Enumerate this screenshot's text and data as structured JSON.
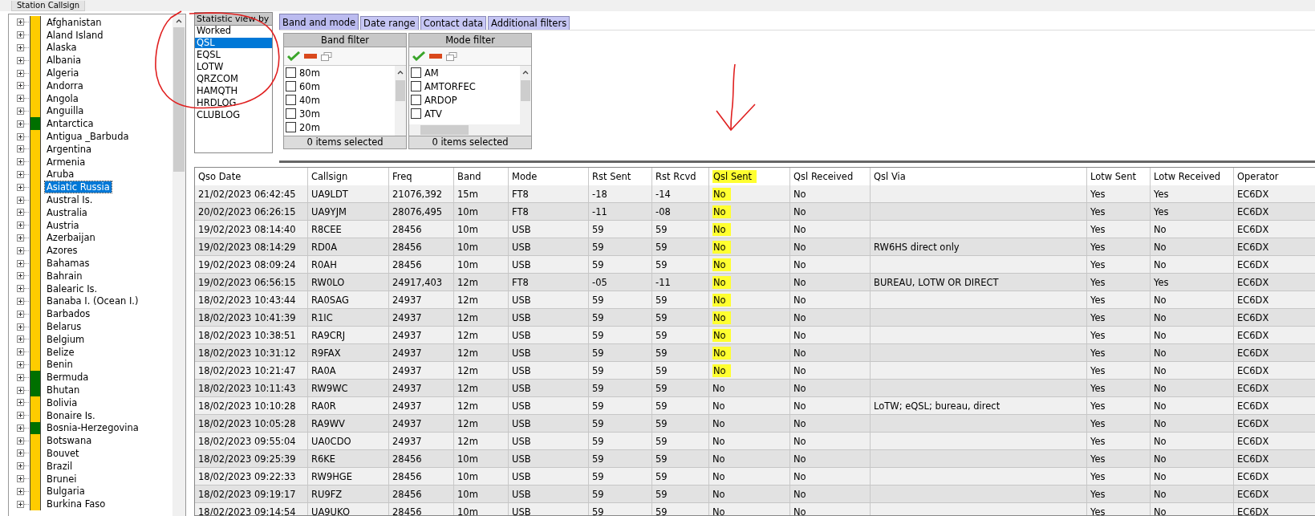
{
  "station_field": {
    "label": "Station Callsign"
  },
  "tree": {
    "items": [
      {
        "label": "Afghanistan",
        "color": "#ffcc00",
        "selected": false
      },
      {
        "label": "Aland Island",
        "color": "#ffcc00",
        "selected": false
      },
      {
        "label": "Alaska",
        "color": "#ffcc00",
        "selected": false
      },
      {
        "label": "Albania",
        "color": "#ffcc00",
        "selected": false
      },
      {
        "label": "Algeria",
        "color": "#ffcc00",
        "selected": false
      },
      {
        "label": "Andorra",
        "color": "#ffcc00",
        "selected": false
      },
      {
        "label": "Angola",
        "color": "#ffcc00",
        "selected": false
      },
      {
        "label": "Anguilla",
        "color": "#ffcc00",
        "selected": false
      },
      {
        "label": "Antarctica",
        "color": "#007000",
        "selected": false
      },
      {
        "label": "Antigua _Barbuda",
        "color": "#ffcc00",
        "selected": false
      },
      {
        "label": "Argentina",
        "color": "#ffcc00",
        "selected": false
      },
      {
        "label": "Armenia",
        "color": "#ffcc00",
        "selected": false
      },
      {
        "label": "Aruba",
        "color": "#ffcc00",
        "selected": false
      },
      {
        "label": "Asiatic Russia",
        "color": "#ffcc00",
        "selected": true
      },
      {
        "label": "Austral Is.",
        "color": "#ffcc00",
        "selected": false
      },
      {
        "label": "Australia",
        "color": "#ffcc00",
        "selected": false
      },
      {
        "label": "Austria",
        "color": "#ffcc00",
        "selected": false
      },
      {
        "label": "Azerbaijan",
        "color": "#ffcc00",
        "selected": false
      },
      {
        "label": "Azores",
        "color": "#ffcc00",
        "selected": false
      },
      {
        "label": "Bahamas",
        "color": "#ffcc00",
        "selected": false
      },
      {
        "label": "Bahrain",
        "color": "#ffcc00",
        "selected": false
      },
      {
        "label": "Balearic Is.",
        "color": "#ffcc00",
        "selected": false
      },
      {
        "label": "Banaba I. (Ocean I.)",
        "color": "#ffcc00",
        "selected": false
      },
      {
        "label": "Barbados",
        "color": "#ffcc00",
        "selected": false
      },
      {
        "label": "Belarus",
        "color": "#ffcc00",
        "selected": false
      },
      {
        "label": "Belgium",
        "color": "#ffcc00",
        "selected": false
      },
      {
        "label": "Belize",
        "color": "#ffcc00",
        "selected": false
      },
      {
        "label": "Benin",
        "color": "#ffcc00",
        "selected": false
      },
      {
        "label": "Bermuda",
        "color": "#007000",
        "selected": false
      },
      {
        "label": "Bhutan",
        "color": "#007000",
        "selected": false
      },
      {
        "label": "Bolivia",
        "color": "#ffcc00",
        "selected": false
      },
      {
        "label": "Bonaire Is.",
        "color": "#ffcc00",
        "selected": false
      },
      {
        "label": "Bosnia-Herzegovina",
        "color": "#007000",
        "selected": false
      },
      {
        "label": "Botswana",
        "color": "#ffcc00",
        "selected": false
      },
      {
        "label": "Bouvet",
        "color": "#ffcc00",
        "selected": false
      },
      {
        "label": "Brazil",
        "color": "#ffcc00",
        "selected": false
      },
      {
        "label": "Brunei",
        "color": "#ffcc00",
        "selected": false
      },
      {
        "label": "Bulgaria",
        "color": "#ffcc00",
        "selected": false
      },
      {
        "label": "Burkina Faso",
        "color": "#ffcc00",
        "selected": false
      }
    ]
  },
  "statistic_view": {
    "title": "Statistic view by",
    "items": [
      {
        "label": "Worked",
        "selected": false
      },
      {
        "label": "QSL",
        "selected": true
      },
      {
        "label": "EQSL",
        "selected": false
      },
      {
        "label": "LOTW",
        "selected": false
      },
      {
        "label": "QRZCOM",
        "selected": false
      },
      {
        "label": "HAMQTH",
        "selected": false
      },
      {
        "label": "HRDLOG",
        "selected": false
      },
      {
        "label": "CLUBLOG",
        "selected": false
      }
    ]
  },
  "tabs": [
    {
      "label": "Band and mode",
      "selected": true
    },
    {
      "label": "Date range",
      "selected": false
    },
    {
      "label": "Contact data",
      "selected": false
    },
    {
      "label": "Additional filters",
      "selected": false
    }
  ],
  "filters": [
    {
      "title": "Band filter",
      "items": [
        {
          "label": "80m",
          "checked": false
        },
        {
          "label": "60m",
          "checked": false
        },
        {
          "label": "40m",
          "checked": false
        },
        {
          "label": "30m",
          "checked": false
        },
        {
          "label": "20m",
          "checked": false
        }
      ],
      "footer": "0 items selected"
    },
    {
      "title": "Mode filter",
      "items": [
        {
          "label": "AM",
          "checked": false
        },
        {
          "label": "AMTORFEC",
          "checked": false
        },
        {
          "label": "ARDOP",
          "checked": false
        },
        {
          "label": "ATV",
          "checked": false
        }
      ],
      "footer": "0 items selected"
    }
  ],
  "table": {
    "columns": [
      {
        "label": "Qso Date",
        "highlighted": false
      },
      {
        "label": "Callsign",
        "highlighted": false
      },
      {
        "label": "Freq",
        "highlighted": false
      },
      {
        "label": "Band",
        "highlighted": false
      },
      {
        "label": "Mode",
        "highlighted": false
      },
      {
        "label": "Rst Sent",
        "highlighted": false
      },
      {
        "label": "Rst Rcvd",
        "highlighted": false
      },
      {
        "label": "Qsl Sent",
        "highlighted": true
      },
      {
        "label": "Qsl Received",
        "highlighted": false
      },
      {
        "label": "Qsl Via",
        "highlighted": false
      },
      {
        "label": "Lotw Sent",
        "highlighted": false
      },
      {
        "label": "Lotw Received",
        "highlighted": false
      },
      {
        "label": "Operator",
        "highlighted": false
      }
    ],
    "rows": [
      {
        "cells": [
          "21/02/2023 06:42:45",
          "UA9LDT",
          "21076,392",
          "15m",
          "FT8",
          "-18",
          "-14",
          "No",
          "No",
          "",
          "Yes",
          "Yes",
          "EC6DX"
        ],
        "qsl_sent_highlighted": true
      },
      {
        "cells": [
          "20/02/2023 06:26:15",
          "UA9YJM",
          "28076,495",
          "10m",
          "FT8",
          "-11",
          "-08",
          "No",
          "No",
          "",
          "Yes",
          "Yes",
          "EC6DX"
        ],
        "qsl_sent_highlighted": true
      },
      {
        "cells": [
          "19/02/2023 08:14:40",
          "R8CEE",
          "28456",
          "10m",
          "USB",
          "59",
          "59",
          "No",
          "No",
          "",
          "Yes",
          "No",
          "EC6DX"
        ],
        "qsl_sent_highlighted": true
      },
      {
        "cells": [
          "19/02/2023 08:14:29",
          "RD0A",
          "28456",
          "10m",
          "USB",
          "59",
          "59",
          "No",
          "No",
          "RW6HS direct only",
          "Yes",
          "No",
          "EC6DX"
        ],
        "qsl_sent_highlighted": true
      },
      {
        "cells": [
          "19/02/2023 08:09:24",
          "R0AH",
          "28456",
          "10m",
          "USB",
          "59",
          "59",
          "No",
          "No",
          "",
          "Yes",
          "No",
          "EC6DX"
        ],
        "qsl_sent_highlighted": true
      },
      {
        "cells": [
          "19/02/2023 06:56:15",
          "RW0LO",
          "24917,403",
          "12m",
          "FT8",
          "-05",
          "-11",
          "No",
          "No",
          "BUREAU, LOTW OR DIRECT",
          "Yes",
          "Yes",
          "EC6DX"
        ],
        "qsl_sent_highlighted": true
      },
      {
        "cells": [
          "18/02/2023 10:43:44",
          "RA0SAG",
          "24937",
          "12m",
          "USB",
          "59",
          "59",
          "No",
          "No",
          "",
          "Yes",
          "No",
          "EC6DX"
        ],
        "qsl_sent_highlighted": true
      },
      {
        "cells": [
          "18/02/2023 10:41:39",
          "R1IC",
          "24937",
          "12m",
          "USB",
          "59",
          "59",
          "No",
          "No",
          "",
          "Yes",
          "No",
          "EC6DX"
        ],
        "qsl_sent_highlighted": true
      },
      {
        "cells": [
          "18/02/2023 10:38:51",
          "RA9CRJ",
          "24937",
          "12m",
          "USB",
          "59",
          "59",
          "No",
          "No",
          "",
          "Yes",
          "No",
          "EC6DX"
        ],
        "qsl_sent_highlighted": true
      },
      {
        "cells": [
          "18/02/2023 10:31:12",
          "R9FAX",
          "24937",
          "12m",
          "USB",
          "59",
          "59",
          "No",
          "No",
          "",
          "Yes",
          "No",
          "EC6DX"
        ],
        "qsl_sent_highlighted": true
      },
      {
        "cells": [
          "18/02/2023 10:21:47",
          "RA0A",
          "24937",
          "12m",
          "USB",
          "59",
          "59",
          "No",
          "No",
          "",
          "Yes",
          "No",
          "EC6DX"
        ],
        "qsl_sent_highlighted": true
      },
      {
        "cells": [
          "18/02/2023 10:11:43",
          "RW9WC",
          "24937",
          "12m",
          "USB",
          "59",
          "59",
          "No",
          "No",
          "",
          "Yes",
          "No",
          "EC6DX"
        ],
        "qsl_sent_highlighted": false
      },
      {
        "cells": [
          "18/02/2023 10:10:28",
          "RA0R",
          "24937",
          "12m",
          "USB",
          "59",
          "59",
          "No",
          "No",
          "LoTW; eQSL; bureau, direct",
          "Yes",
          "No",
          "EC6DX"
        ],
        "qsl_sent_highlighted": false
      },
      {
        "cells": [
          "18/02/2023 10:05:28",
          "RA9WV",
          "24937",
          "12m",
          "USB",
          "59",
          "59",
          "No",
          "No",
          "",
          "Yes",
          "No",
          "EC6DX"
        ],
        "qsl_sent_highlighted": false
      },
      {
        "cells": [
          "18/02/2023 09:55:04",
          "UA0CDO",
          "24937",
          "12m",
          "USB",
          "59",
          "59",
          "No",
          "No",
          "",
          "Yes",
          "No",
          "EC6DX"
        ],
        "qsl_sent_highlighted": false
      },
      {
        "cells": [
          "18/02/2023 09:25:39",
          "R6KE",
          "28456",
          "10m",
          "USB",
          "59",
          "59",
          "No",
          "No",
          "",
          "Yes",
          "No",
          "EC6DX"
        ],
        "qsl_sent_highlighted": false
      },
      {
        "cells": [
          "18/02/2023 09:22:33",
          "RW9HGE",
          "28456",
          "10m",
          "USB",
          "59",
          "59",
          "No",
          "No",
          "",
          "Yes",
          "No",
          "EC6DX"
        ],
        "qsl_sent_highlighted": false
      },
      {
        "cells": [
          "18/02/2023 09:19:17",
          "RU9FZ",
          "28456",
          "10m",
          "USB",
          "59",
          "59",
          "No",
          "No",
          "",
          "Yes",
          "No",
          "EC6DX"
        ],
        "qsl_sent_highlighted": false
      },
      {
        "cells": [
          "18/02/2023 09:14:54",
          "UA9UKO",
          "28456",
          "10m",
          "USB",
          "59",
          "59",
          "No",
          "No",
          "",
          "Yes",
          "No",
          "EC6DX"
        ],
        "qsl_sent_highlighted": false
      }
    ]
  }
}
